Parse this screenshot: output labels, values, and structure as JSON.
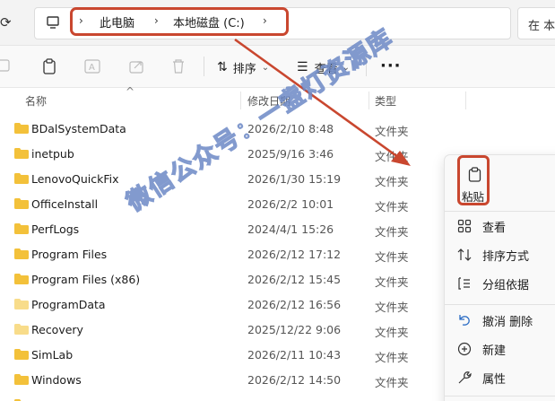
{
  "address_bar": {
    "breadcrumbs": [
      "此电脑",
      "本地磁盘 (C:)"
    ],
    "search_placeholder": "在 本"
  },
  "toolbar": {
    "sort_label": "排序",
    "view_label": "查看",
    "more_label": "···"
  },
  "columns": {
    "name": "名称",
    "date": "修改日期",
    "type": "类型"
  },
  "files": [
    {
      "name": "BDalSystemData",
      "date": "2026/2/10 8:48",
      "type": "文件夹"
    },
    {
      "name": "inetpub",
      "date": "2025/9/16 3:46",
      "type": "文件夹"
    },
    {
      "name": "LenovoQuickFix",
      "date": "2026/1/30 15:19",
      "type": "文件夹"
    },
    {
      "name": "OfficeInstall",
      "date": "2026/2/2 10:01",
      "type": "文件夹"
    },
    {
      "name": "PerfLogs",
      "date": "2024/4/1 15:26",
      "type": "文件夹"
    },
    {
      "name": "Program Files",
      "date": "2026/2/12 17:12",
      "type": "文件夹"
    },
    {
      "name": "Program Files (x86)",
      "date": "2026/2/12 15:45",
      "type": "文件夹"
    },
    {
      "name": "ProgramData",
      "date": "2026/2/12 16:56",
      "type": "文件夹"
    },
    {
      "name": "Recovery",
      "date": "2025/12/22 9:06",
      "type": "文件夹"
    },
    {
      "name": "SimLab",
      "date": "2026/2/11 10:43",
      "type": "文件夹"
    },
    {
      "name": "Windows",
      "date": "2026/2/12 14:50",
      "type": "文件夹"
    }
  ],
  "context_menu": {
    "paste_label": "粘贴",
    "items": [
      {
        "label": "查看",
        "icon": "grid-icon"
      },
      {
        "label": "排序方式",
        "icon": "sort-icon"
      },
      {
        "label": "分组依据",
        "icon": "group-icon"
      },
      {
        "label": "撤消 删除",
        "icon": "undo-icon"
      },
      {
        "label": "新建",
        "icon": "plus-icon"
      },
      {
        "label": "属性",
        "icon": "wrench-icon"
      }
    ]
  },
  "watermark_text": "微信公众号：一盏灯资源库",
  "colors": {
    "annotation_red": "#c9472f",
    "folder_yellow": "#f3c13a"
  }
}
